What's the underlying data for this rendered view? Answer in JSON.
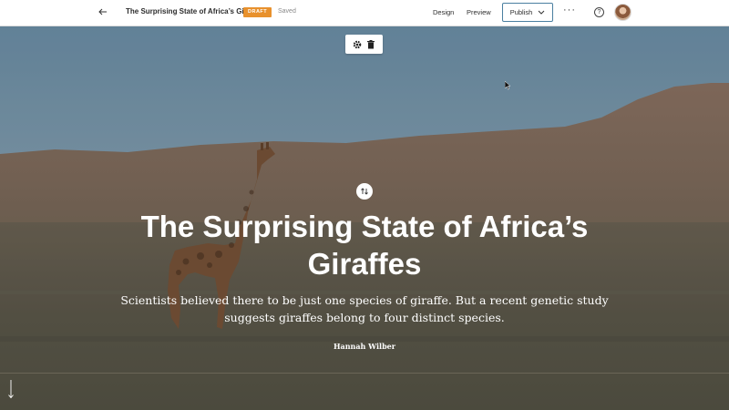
{
  "topbar": {
    "back_icon": "arrow-left-icon",
    "story_title": "The Surprising State of Africa’s Giraffes",
    "draft_badge": "DRAFT",
    "saved_status": "Saved",
    "design_label": "Design",
    "preview_label": "Preview",
    "publish_label": "Publish",
    "more_icon": "more-horizontal-icon",
    "help_icon": "help-circle-icon",
    "avatar_icon": "user-avatar",
    "accent_color": "#e8912d",
    "publish_border_color": "#4a7fa0"
  },
  "hero": {
    "toolbar": {
      "settings_icon": "gear-icon",
      "delete_icon": "trash-icon"
    },
    "swap_icon": "swap-vertical-icon",
    "title": "The Surprising State of Africa’s Giraffes",
    "subtitle": "Scientists believed there to be just one species of giraffe. But a recent genetic study suggests giraffes belong to four distinct species.",
    "author": "Hannah Wilber",
    "scroll_icon": "arrow-down-icon"
  }
}
